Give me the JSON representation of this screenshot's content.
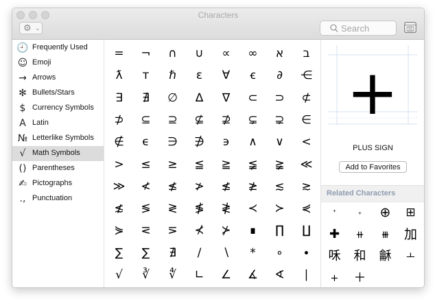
{
  "window": {
    "title": "Characters"
  },
  "toolbar": {
    "gear_icon": "gear-icon",
    "search_placeholder": "Search"
  },
  "sidebar": {
    "items": [
      {
        "icon": "🕘",
        "label": "Frequently Used",
        "name": "clock"
      },
      {
        "icon": "☺",
        "label": "Emoji",
        "name": "smiley"
      },
      {
        "icon": "→",
        "label": "Arrows",
        "name": "arrow"
      },
      {
        "icon": "✻",
        "label": "Bullets/Stars",
        "name": "asterisk"
      },
      {
        "icon": "$",
        "label": "Currency Symbols",
        "name": "dollar"
      },
      {
        "icon": "A",
        "label": "Latin",
        "name": "latin-a"
      },
      {
        "icon": "№",
        "label": "Letterlike Symbols",
        "name": "numero"
      },
      {
        "icon": "√",
        "label": "Math Symbols",
        "name": "sqrt",
        "selected": true
      },
      {
        "icon": "()",
        "label": "Parentheses",
        "name": "parens"
      },
      {
        "icon": "✍",
        "label": "Pictographs",
        "name": "pictograph"
      },
      {
        "icon": ".,",
        "label": "Punctuation",
        "name": "punct"
      }
    ]
  },
  "grid": {
    "rows": [
      [
        "=",
        "¬",
        "∩",
        "∪",
        "∝",
        "∞",
        "א",
        "ב"
      ],
      [
        "ƛ",
        "ᴛ",
        "ℏ",
        "ɛ",
        "∀",
        "ꞓ",
        "∂",
        "⋲"
      ],
      [
        "∃",
        "∄",
        "∅",
        "∆",
        "∇",
        "⊂",
        "⊃",
        "⊄"
      ],
      [
        "⊅",
        "⊆",
        "⊇",
        "⊈",
        "⊉",
        "⊊",
        "⊋",
        "∈"
      ],
      [
        "∉",
        "ϵ",
        "∋",
        "∌",
        "϶",
        "∧",
        "∨",
        "<"
      ],
      [
        ">",
        "≤",
        "≥",
        "≦",
        "≧",
        "≨",
        "≩",
        "≪"
      ],
      [
        "≫",
        "≮",
        "≰",
        "≯",
        "≰",
        "≱",
        "≲",
        "≳"
      ],
      [
        "≴",
        "≶",
        "≷",
        "≸",
        "≹",
        "≺",
        "≻",
        "⋞"
      ],
      [
        "⋟",
        "⋜",
        "⋝",
        "⊀",
        "⊁",
        "∎",
        "∏",
        "∐"
      ],
      [
        "∑",
        "∑",
        "∄",
        "/",
        "∖",
        "*",
        "∘",
        "∙"
      ],
      [
        "√",
        "∛",
        "∜",
        "∟",
        "∠",
        "∡",
        "∢",
        "∣"
      ],
      [
        "∤",
        "∥",
        "∦",
        "∫",
        "∬",
        "∭",
        "∮",
        "∯"
      ]
    ]
  },
  "detail": {
    "glyph": "+",
    "name": "PLUS SIGN",
    "add_favorites_label": "Add to Favorites"
  },
  "related": {
    "heading": "Related Characters",
    "rows": [
      [
        "⁺",
        "₊",
        "⊕",
        "⊞"
      ],
      [
        "✚",
        "⧺",
        "⧻",
        "加"
      ],
      [
        "咊",
        "和",
        "龢",
        "ㅗ"
      ],
      [
        "+",
        "＋"
      ]
    ]
  },
  "colors": {
    "selection": "#dcdcdc",
    "related_heading": "#8e9cb0"
  }
}
